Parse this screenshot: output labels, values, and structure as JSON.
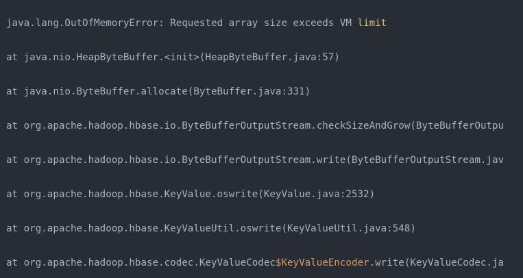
{
  "code": {
    "lines": [
      {
        "a": "java.lang.OutOfMemoryError: Requested array size exceeds VM ",
        "b": "limit",
        "c": "",
        "d": ""
      },
      {
        "a": "at java.nio.HeapByteBuffer.<init>(HeapByteBuffer.java:57)",
        "b": "",
        "c": "",
        "d": ""
      },
      {
        "a": "at java.nio.ByteBuffer.allocate(ByteBuffer.java:331)",
        "b": "",
        "c": "",
        "d": ""
      },
      {
        "a": "at org.apache.hadoop.hbase.io.ByteBufferOutputStream.checkSizeAndGrow(ByteBufferOutpu",
        "b": "",
        "c": "",
        "d": ""
      },
      {
        "a": "at org.apache.hadoop.hbase.io.ByteBufferOutputStream.write(ByteBufferOutputStream.jav",
        "b": "",
        "c": "",
        "d": ""
      },
      {
        "a": "at org.apache.hadoop.hbase.KeyValue.oswrite(KeyValue.java:2532)",
        "b": "",
        "c": "",
        "d": ""
      },
      {
        "a": "at org.apache.hadoop.hbase.KeyValueUtil.oswrite(KeyValueUtil.java:548)",
        "b": "",
        "c": "",
        "d": ""
      },
      {
        "a": "at org.apache.hadoop.hbase.codec.KeyValueCodec",
        "b": "",
        "c": "$KeyValueEncoder",
        "d": ".write(KeyValueCodec.ja"
      }
    ]
  },
  "colors": {
    "background": "#282c34",
    "text": "#abb2bf",
    "keyword": "#e5c07b",
    "variable": "#d19a66"
  }
}
